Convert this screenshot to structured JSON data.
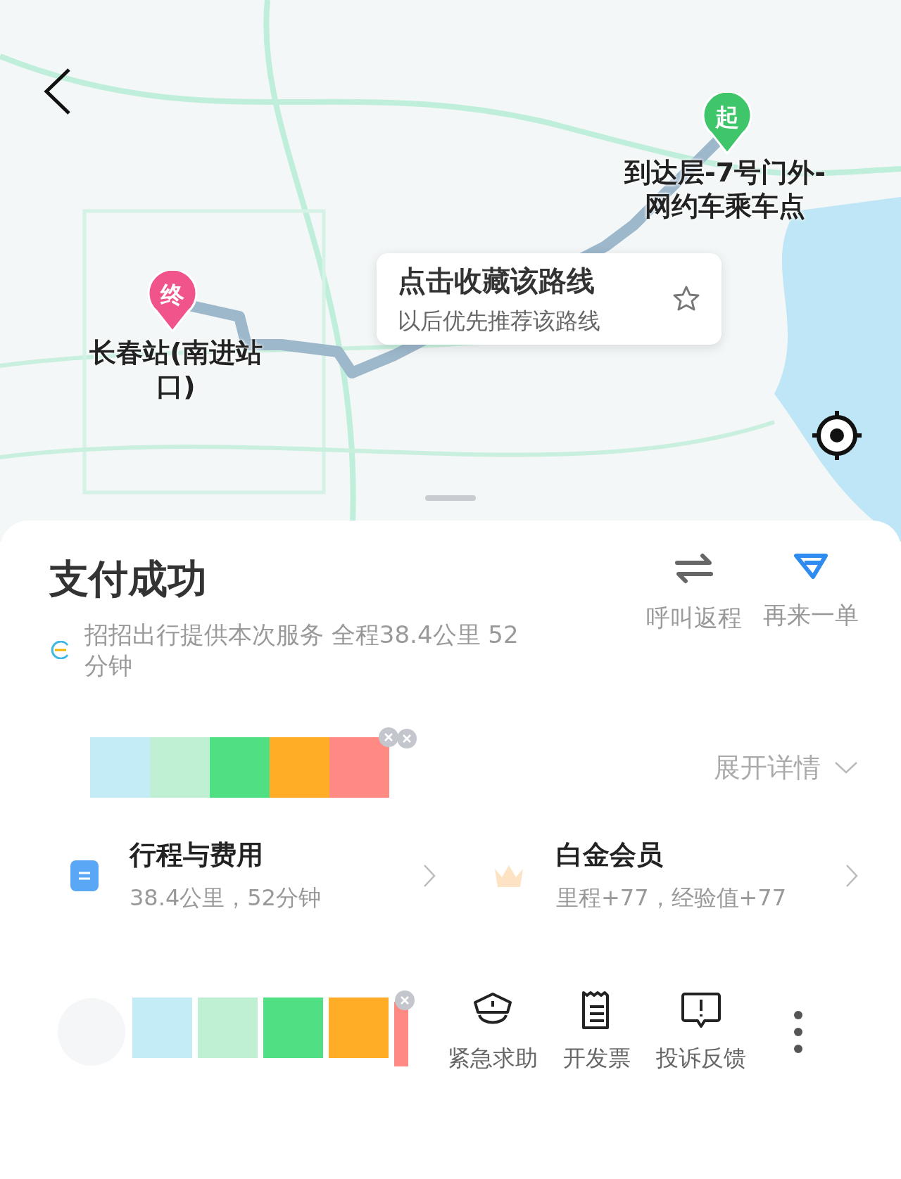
{
  "map": {
    "kind": "picture",
    "start_pin": {
      "glyph": "起",
      "label": "到达层-7号门外-网约车乘车点"
    },
    "end_pin": {
      "glyph": "终",
      "label": "长春站(南进站口)"
    },
    "favorite_tip": {
      "title": "点击收藏该路线",
      "subtitle": "以后优先推荐该路线"
    }
  },
  "status": {
    "title": "支付成功",
    "provider": "招招出行提供本次服务 全程38.4公里 52分钟",
    "actions": [
      {
        "kind": "return",
        "label": "呼叫返程"
      },
      {
        "kind": "again",
        "label": "再来一单"
      }
    ]
  },
  "strip_top": [
    {
      "color": "#c4ecf6"
    },
    {
      "color": "#c0f0d4"
    },
    {
      "color": "#50e083"
    },
    {
      "color": "#ffad27"
    },
    {
      "color": "#ff8983"
    }
  ],
  "expand": {
    "label": "展开详情"
  },
  "cards": [
    {
      "kind": "trip",
      "title": "行程与费用",
      "subtitle": "38.4公里，52分钟"
    },
    {
      "kind": "member",
      "title": "白金会员",
      "subtitle": "里程+77，经验值+77"
    }
  ],
  "strip_bottom": [
    {
      "color": "#c4ecf6"
    },
    {
      "color": "#c0f0d4"
    },
    {
      "color": "#50e083"
    },
    {
      "color": "#ffad27"
    },
    {
      "color": "#ff8983"
    }
  ],
  "tools": [
    {
      "kind": "sos",
      "label": "紧急求助"
    },
    {
      "kind": "invoice",
      "label": "开发票"
    },
    {
      "kind": "feedback",
      "label": "投诉反馈"
    }
  ]
}
